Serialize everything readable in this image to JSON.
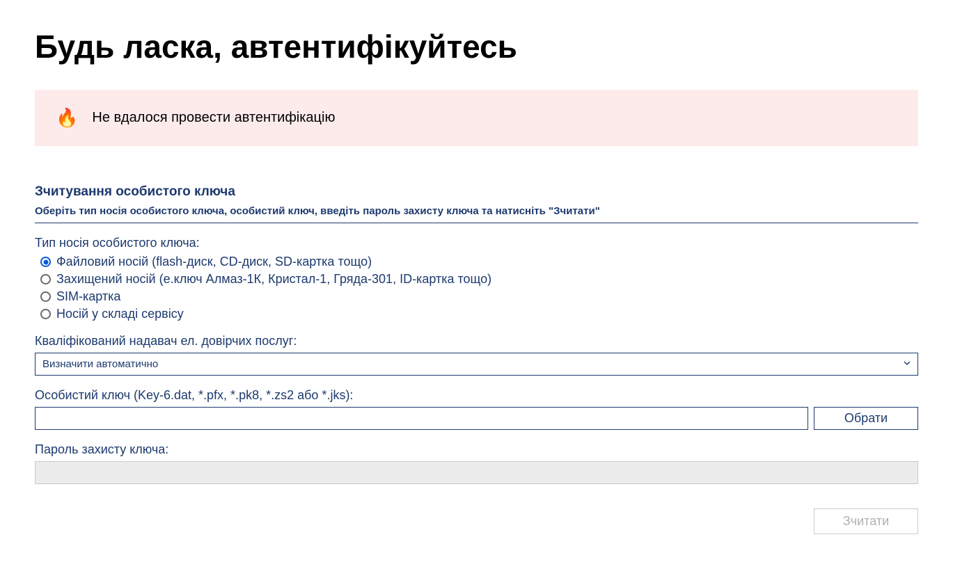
{
  "page": {
    "title": "Будь ласка, автентифікуйтесь"
  },
  "error": {
    "message": "Не вдалося провести автентифікацію"
  },
  "section": {
    "title": "Зчитування особистого ключа",
    "subtitle": "Оберіть тип носія особистого ключа, особистий ключ, введіть пароль захисту ключа та натисніть \"Зчитати\""
  },
  "keyType": {
    "label": "Тип носія особистого ключа:",
    "options": [
      "Файловий носій (flash-диск, CD-диск, SD-картка тощо)",
      "Захищений носій (е.ключ Алмаз-1К, Кристал-1, Гряда-301, ID-картка тощо)",
      "SIM-картка",
      "Носій у складі сервісу"
    ]
  },
  "provider": {
    "label": "Кваліфікований надавач ел. довірчих послуг:",
    "selected": "Визначити автоматично"
  },
  "keyFile": {
    "label": "Особистий ключ (Key-6.dat, *.pfx, *.pk8, *.zs2 або *.jks):",
    "value": "",
    "chooseLabel": "Обрати"
  },
  "password": {
    "label": "Пароль захисту ключа:",
    "value": ""
  },
  "submit": {
    "label": "Зчитати"
  }
}
